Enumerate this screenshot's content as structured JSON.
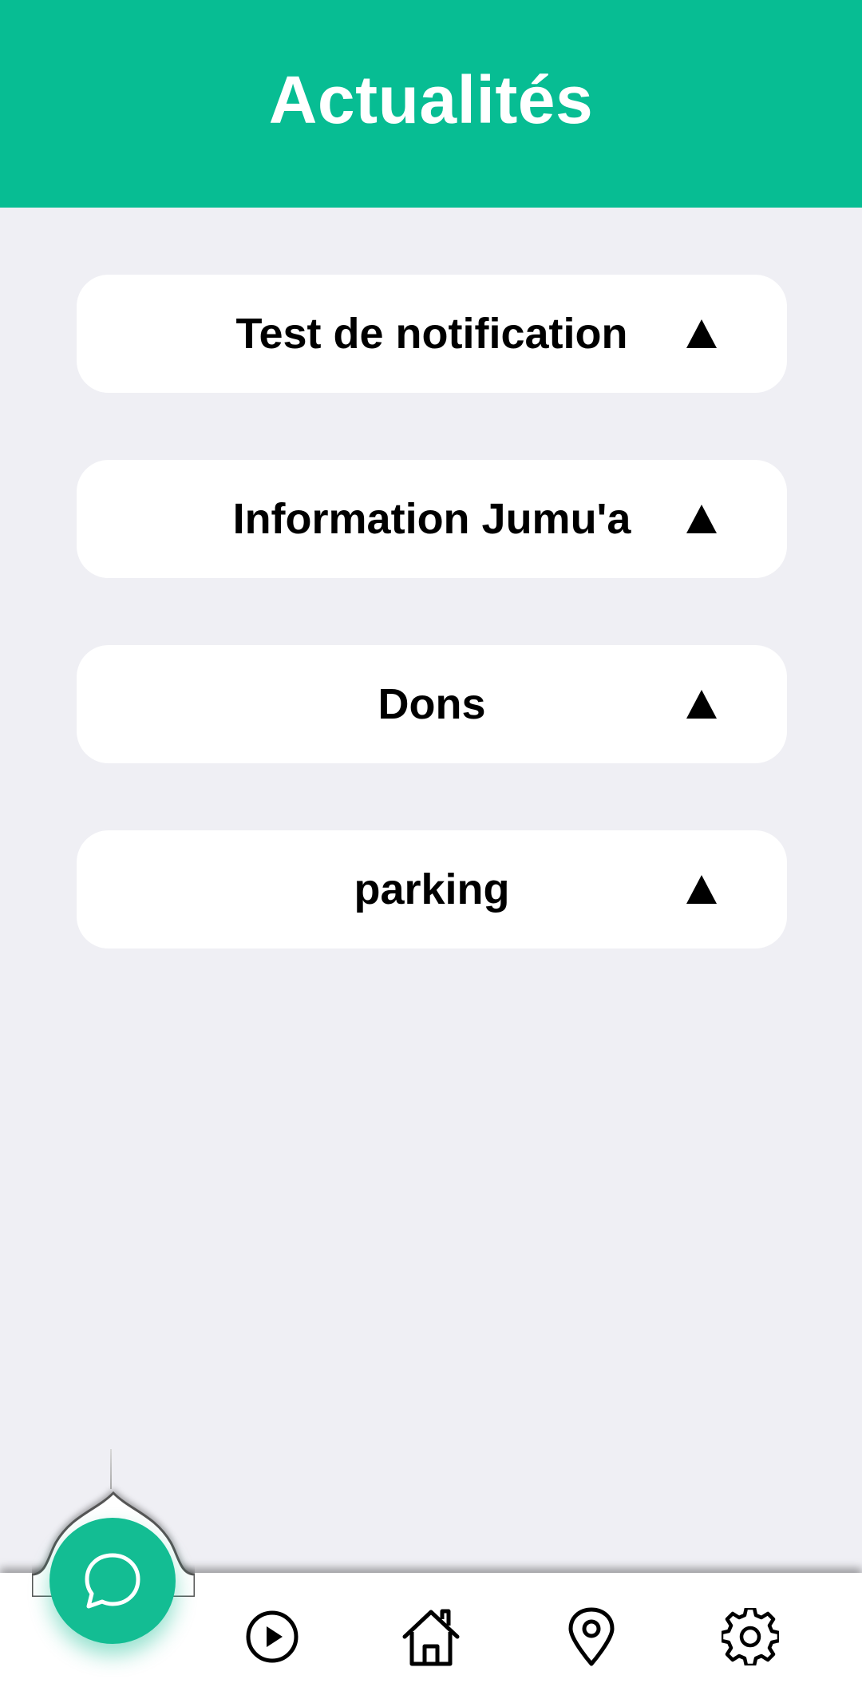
{
  "header": {
    "title": "Actualités"
  },
  "news": {
    "items": [
      {
        "title": "Test de notification",
        "icon": "triangle-up-icon"
      },
      {
        "title": "Information Jumu'a",
        "icon": "triangle-up-icon"
      },
      {
        "title": "Dons",
        "icon": "triangle-up-icon"
      },
      {
        "title": "parking",
        "icon": "triangle-up-icon"
      }
    ]
  },
  "bottom_nav": {
    "fab_icon": "chat-bubble-icon",
    "items": [
      {
        "icon": "play-circle-icon"
      },
      {
        "icon": "home-icon"
      },
      {
        "icon": "location-pin-icon"
      },
      {
        "icon": "gear-icon"
      }
    ]
  },
  "colors": {
    "accent": "#07bd93",
    "background": "#efeff4",
    "card": "#ffffff",
    "text": "#000000"
  }
}
